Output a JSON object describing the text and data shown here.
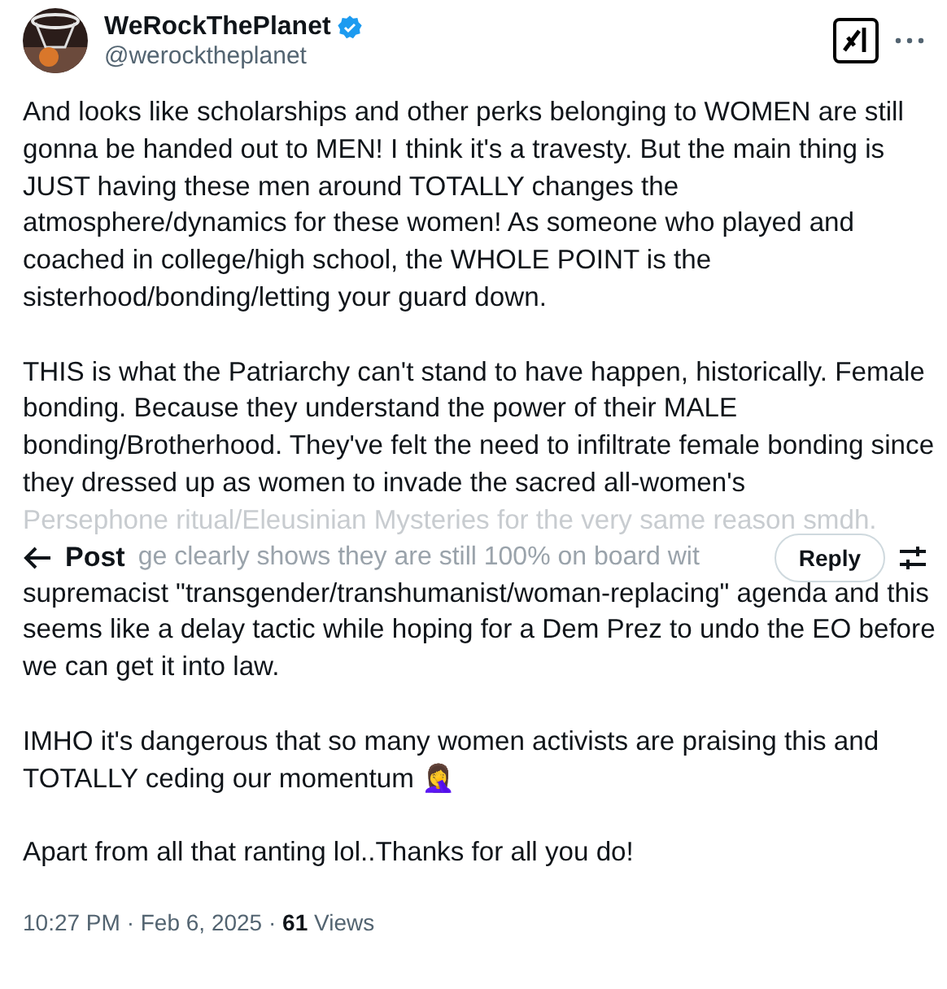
{
  "author": {
    "name": "WeRockThePlanet",
    "handle": "@werocktheplanet",
    "verified": true
  },
  "paragraph_1": "And looks like scholarships and other perks belonging to WOMEN are still gonna be handed out to MEN! I think it's a travesty. But the main thing is JUST having these men around TOTALLY changes the atmosphere/dynamics for these women! As someone who played and coached in college/high school, the WHOLE POINT is the sisterhood/bonding/letting your guard down.",
  "paragraph_2": {
    "text": "THIS is what the Patriarchy can't stand to have happen, historically. Female bonding. Because they understand the power of their MALE bonding/Brotherhood. They've felt the need to infiltrate female bonding since they dressed up as women to invade the sacred all-women's",
    "faded_line": "Persephone ritual/Eleusinian Mysteries for the very same reason smdh.",
    "covered_fragment": "ge clearly shows they are still 100% on board wit",
    "continued": "supremacist \"transgender/transhumanist/woman-replacing\" agenda and this seems  like a delay tactic while hoping for a Dem Prez to undo the EO before we can get it into law."
  },
  "paragraphs": [
    "IMHO it's dangerous that so many women activists are praising this and TOTALLY ceding our momentum 🤦‍♀️",
    "Apart from all that ranting lol..Thanks for all you do!"
  ],
  "meta": "10:27 PM · Feb 6, 2025 · **61** Views",
  "header": {
    "title": "Post",
    "reply_button": "Reply"
  }
}
